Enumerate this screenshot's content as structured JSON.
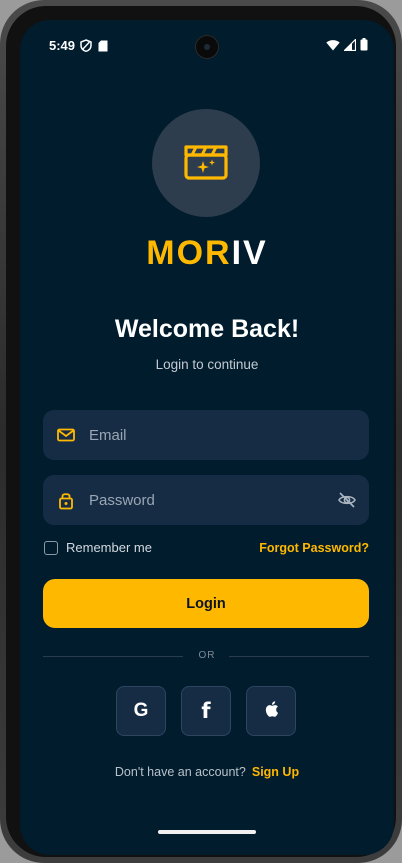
{
  "status_bar": {
    "time": "5:49"
  },
  "brand": {
    "accent": "MOR",
    "rest": "IV",
    "accent_color": "#ffb800"
  },
  "header": {
    "title": "Welcome Back!",
    "subtitle": "Login to continue"
  },
  "form": {
    "email_placeholder": "Email",
    "email_value": "",
    "password_placeholder": "Password",
    "password_value": "",
    "remember_label": "Remember me",
    "remember_checked": false,
    "forgot_label": "Forgot Password?",
    "login_label": "Login"
  },
  "divider": {
    "label": "OR"
  },
  "social": {
    "google_label": "G",
    "facebook_label": "f",
    "apple_icon": "apple-icon"
  },
  "signup": {
    "prompt": "Don't have an account?",
    "link_label": "Sign Up"
  },
  "colors": {
    "background": "#001c2d",
    "field": "#162c44",
    "accent": "#ffb800"
  },
  "icons": [
    "shield-icon",
    "sd-card-icon",
    "wifi-icon",
    "signal-icon",
    "battery-icon",
    "clapperboard-icon",
    "mail-icon",
    "lock-icon",
    "eye-off-icon",
    "apple-icon"
  ]
}
